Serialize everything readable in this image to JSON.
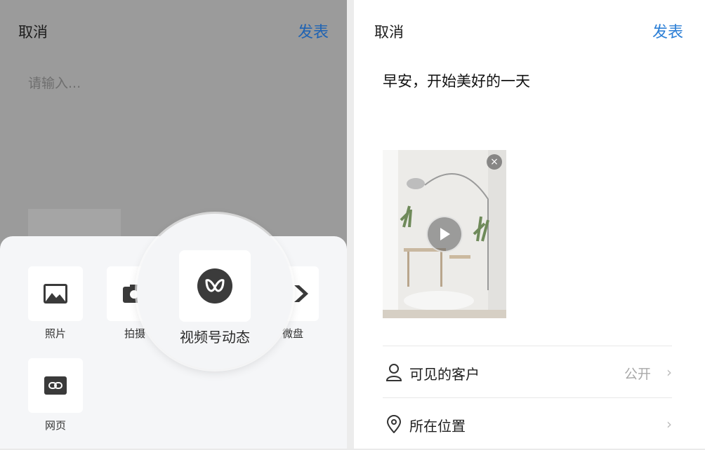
{
  "left_panel": {
    "cancel": "取消",
    "publish": "发表",
    "input_placeholder": "请输入...",
    "sheet_items": [
      {
        "label": "照片",
        "icon": "image-icon"
      },
      {
        "label": "拍摄",
        "icon": "camera-icon"
      },
      {
        "label": "视频号动态",
        "icon": "channels-icon"
      },
      {
        "label": "微盘",
        "icon": "drive-icon"
      },
      {
        "label": "网页",
        "icon": "link-icon"
      }
    ],
    "partial_label": "微盘"
  },
  "right_panel": {
    "cancel": "取消",
    "publish": "发表",
    "post_text": "早安，开始美好的一天",
    "close_glyph": "×",
    "rows": [
      {
        "label": "可见的客户",
        "value": "公开",
        "icon": "person-icon"
      },
      {
        "label": "所在位置",
        "value": "",
        "icon": "location-icon"
      }
    ],
    "chevron": "›"
  },
  "colors": {
    "overlay": "#9b9b9b",
    "publish_blue": "#2c7fd6",
    "sheet_bg": "#f5f6f8"
  }
}
